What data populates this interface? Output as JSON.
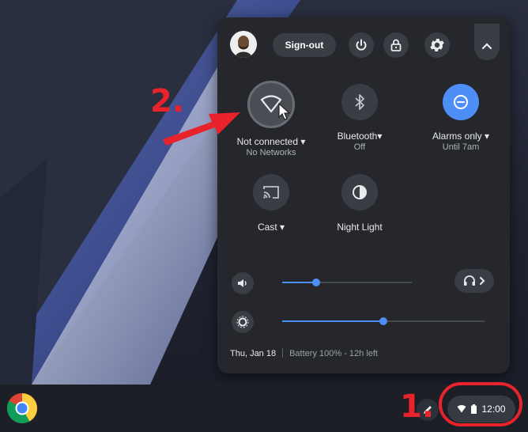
{
  "header": {
    "sign_out_label": "Sign-out"
  },
  "tiles": [
    {
      "label": "Not connected ▾",
      "sub": "No Networks",
      "icon": "wifi-off-icon"
    },
    {
      "label": "Bluetooth▾",
      "sub": "Off",
      "icon": "bluetooth-icon"
    },
    {
      "label": "Alarms only ▾",
      "sub": "Until 7am",
      "icon": "do-not-disturb-icon"
    },
    {
      "label": "Cast ▾",
      "sub": "",
      "icon": "cast-icon"
    },
    {
      "label": "Night Light",
      "sub": "",
      "icon": "night-light-icon"
    }
  ],
  "sliders": {
    "volume_level": 0.26,
    "brightness_level": 0.5
  },
  "footer": {
    "date": "Thu, Jan 18",
    "battery": "Battery 100% - 12h left"
  },
  "shelf": {
    "time": "12:00"
  },
  "annotations": {
    "step_1": "1.",
    "step_2": "2."
  },
  "colors": {
    "accent": "#4e8ef7",
    "annotation_red": "#e8232c",
    "panel_bg": "#25272c"
  }
}
